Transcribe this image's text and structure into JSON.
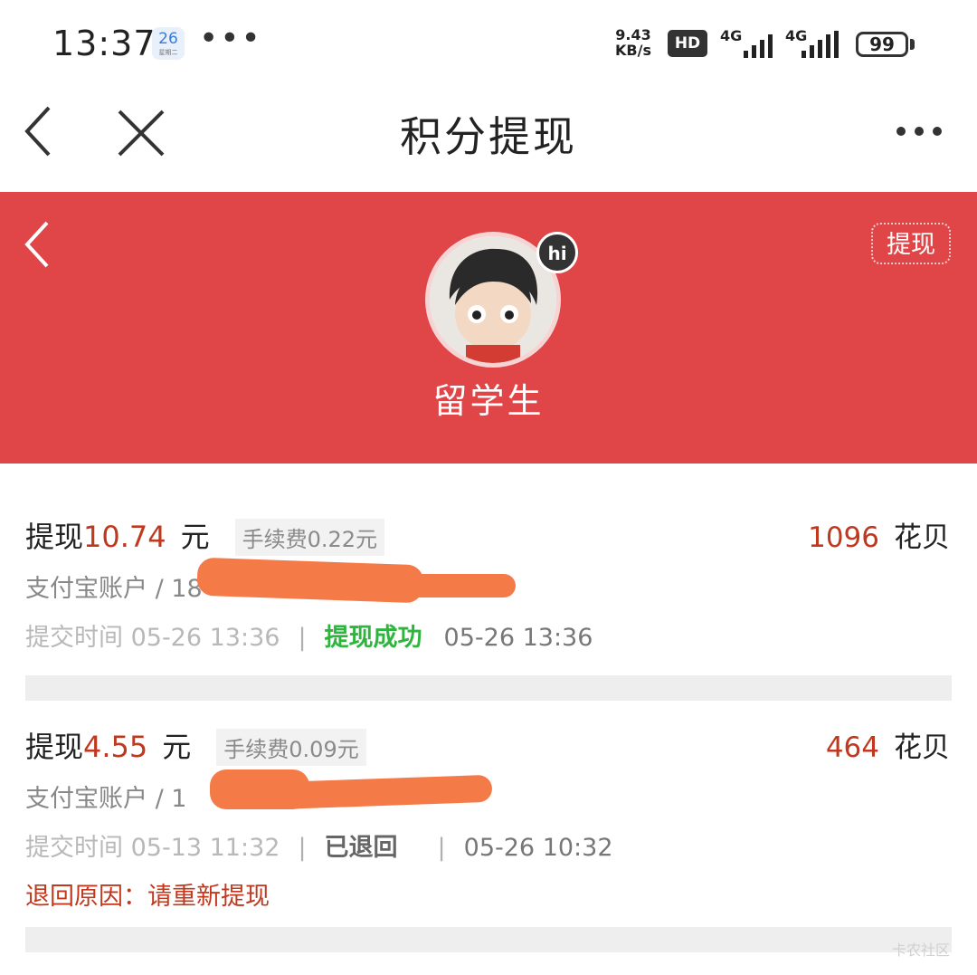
{
  "status_bar": {
    "time": "13:37",
    "calendar_day": "26",
    "calendar_sub": "星期二",
    "speed_value": "9.43",
    "speed_unit": "KB/s",
    "hd_label": "HD",
    "net1": "4G",
    "net2": "4G",
    "battery": "99"
  },
  "nav": {
    "title": "积分提现"
  },
  "header": {
    "withdraw_button": "提现",
    "hi_badge": "hi",
    "username": "留学生"
  },
  "records": [
    {
      "prefix": "提现",
      "amount": "10.74",
      "unit": "元",
      "fee": "手续费0.22元",
      "points": "1096",
      "points_label": "花贝",
      "account": "支付宝账户 / 18",
      "submit_time": "提交时间 05-26 13:36",
      "status": "提现成功",
      "status_time": "05-26 13:36"
    },
    {
      "prefix": "提现",
      "amount": "4.55",
      "unit": "元",
      "fee": "手续费0.09元",
      "points": "464",
      "points_label": "花贝",
      "account": "支付宝账户 / 1",
      "submit_time": "提交时间 05-13 11:32",
      "status": "已退回",
      "status_time": "05-26 10:32",
      "reason": "退回原因：请重新提现"
    }
  ],
  "colors": {
    "header_red": "#e04548",
    "amount_red": "#c0391f",
    "success_green": "#2fb43e",
    "redaction_orange": "#f47b48"
  },
  "watermark": "卡农社区"
}
